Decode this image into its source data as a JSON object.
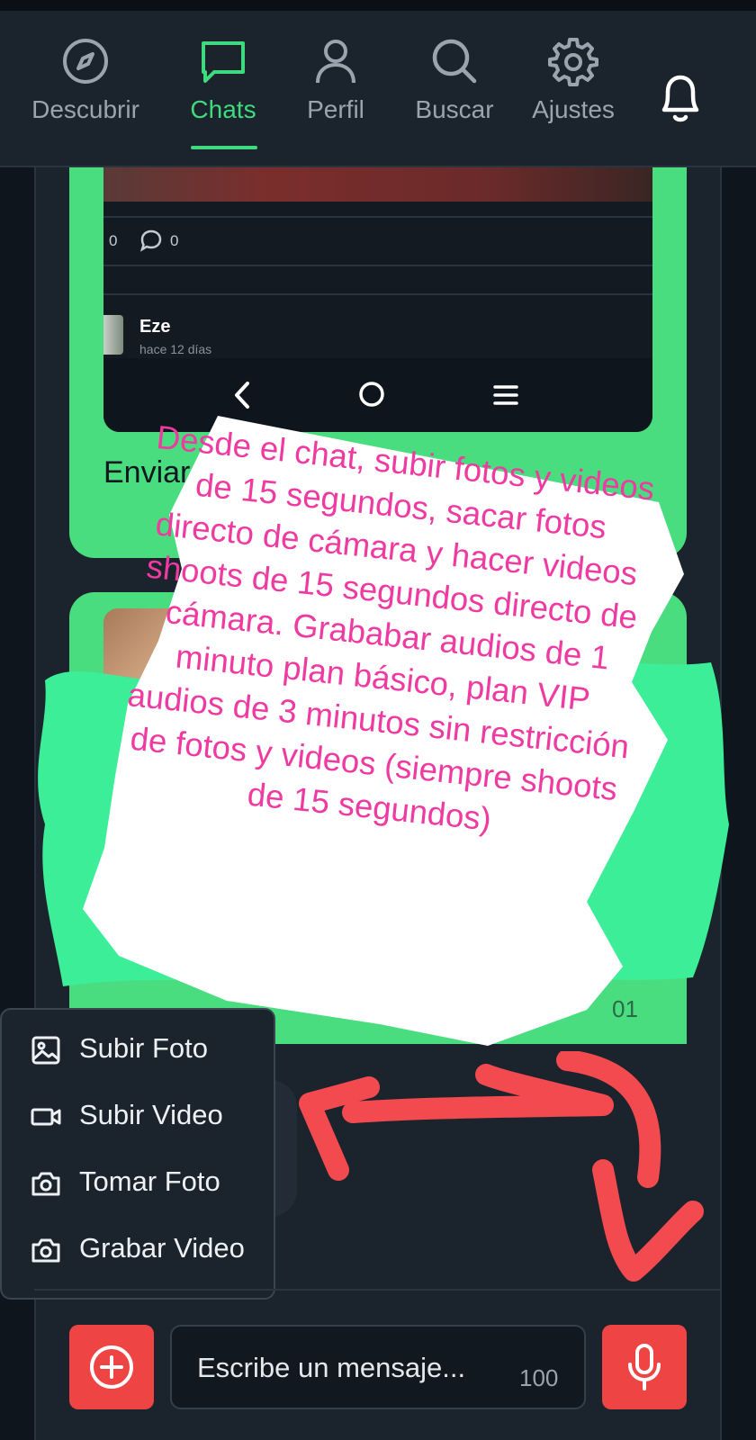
{
  "nav": {
    "items": [
      {
        "label": "Descubrir",
        "icon": "compass-icon",
        "active": false
      },
      {
        "label": "Chats",
        "icon": "chat-bubble-icon",
        "active": true
      },
      {
        "label": "Perfil",
        "icon": "user-icon",
        "active": false
      },
      {
        "label": "Buscar",
        "icon": "search-icon",
        "active": false
      },
      {
        "label": "Ajustes",
        "icon": "gear-icon",
        "active": false
      }
    ],
    "notifications_icon": "bell-icon",
    "active_color": "#3fd97e"
  },
  "chat": {
    "message1": {
      "post_likes": "0",
      "post_comments": "0",
      "post_author": "Eze",
      "post_time": "hace 12 días",
      "caption": "Enviar"
    },
    "message2": {
      "time": "01"
    },
    "bubble_color": "#49dd7f"
  },
  "annotation": {
    "text": "Desde el chat, subir fotos y videos de 15 segundos, sacar fotos directo de cámara y hacer videos shoots de 15 segundos directo de cámara. Grababar audios de 1 minuto plan básico, plan VIP audios de 3 minutos sin restricción de fotos y videos (siempre shoots de 15 segundos)",
    "text_color": "#ee3aa1"
  },
  "attach_menu": {
    "items": [
      {
        "label": "Subir Foto",
        "icon": "image-icon"
      },
      {
        "label": "Subir Video",
        "icon": "video-camera-icon"
      },
      {
        "label": "Tomar Foto",
        "icon": "camera-icon"
      },
      {
        "label": "Grabar Video",
        "icon": "camera-icon"
      }
    ]
  },
  "composer": {
    "placeholder": "Escribe un mensaje...",
    "char_counter": "100",
    "attach_icon": "plus-circle-icon",
    "mic_icon": "microphone-icon",
    "button_color": "#ef4444"
  }
}
